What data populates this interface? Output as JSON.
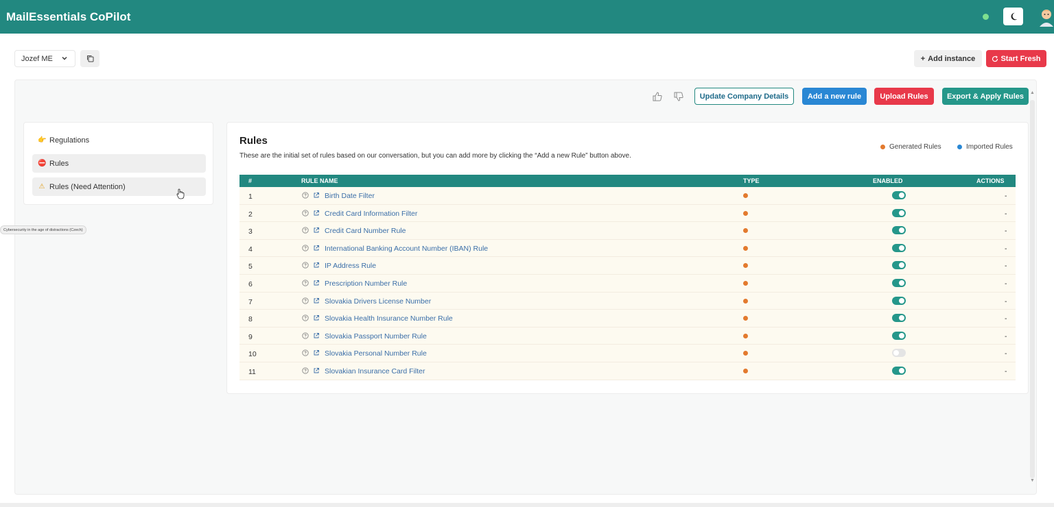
{
  "app": {
    "title": "MailEssentials CoPilot",
    "status_color": "#7ee08f"
  },
  "toolbar": {
    "instance_selected": "Jozef ME",
    "add_instance_label": "Add instance",
    "start_fresh_label": "Start Fresh"
  },
  "actions": {
    "update_company_label": "Update Company Details",
    "add_rule_label": "Add a new rule",
    "upload_rules_label": "Upload Rules",
    "export_apply_label": "Export & Apply Rules"
  },
  "sidebar": {
    "items": [
      {
        "label": "Regulations",
        "icon": "pointing-hand-icon",
        "active": false
      },
      {
        "label": "Rules",
        "icon": "no-entry-icon",
        "active": true
      },
      {
        "label": "Rules (Need Attention)",
        "icon": "warning-icon",
        "active": true
      }
    ]
  },
  "tooltip": "Cybersecurity in the age of distractions (Czech)",
  "rules": {
    "title": "Rules",
    "description": "These are the initial set of rules based on our conversation, but you can add more by clicking the “Add a new Rule” button above.",
    "legend": [
      {
        "label": "Generated Rules",
        "color": "#e37a2e"
      },
      {
        "label": "Imported Rules",
        "color": "#2987d4"
      }
    ],
    "columns": [
      "#",
      "RULE NAME",
      "TYPE",
      "ENABLED",
      "ACTIONS"
    ],
    "rows": [
      {
        "num": "1",
        "name": "Birth Date Filter",
        "type": "generated",
        "enabled": true,
        "actions": "-"
      },
      {
        "num": "2",
        "name": "Credit Card Information Filter",
        "type": "generated",
        "enabled": true,
        "actions": "-"
      },
      {
        "num": "3",
        "name": "Credit Card Number Rule",
        "type": "generated",
        "enabled": true,
        "actions": "-"
      },
      {
        "num": "4",
        "name": "International Banking Account Number (IBAN) Rule",
        "type": "generated",
        "enabled": true,
        "actions": "-"
      },
      {
        "num": "5",
        "name": "IP Address Rule",
        "type": "generated",
        "enabled": true,
        "actions": "-"
      },
      {
        "num": "6",
        "name": "Prescription Number Rule",
        "type": "generated",
        "enabled": true,
        "actions": "-"
      },
      {
        "num": "7",
        "name": "Slovakia Drivers License Number",
        "type": "generated",
        "enabled": true,
        "actions": "-"
      },
      {
        "num": "8",
        "name": "Slovakia Health Insurance Number Rule",
        "type": "generated",
        "enabled": true,
        "actions": "-"
      },
      {
        "num": "9",
        "name": "Slovakia Passport Number Rule",
        "type": "generated",
        "enabled": true,
        "actions": "-"
      },
      {
        "num": "10",
        "name": "Slovakia Personal Number Rule",
        "type": "generated",
        "enabled": false,
        "actions": "-"
      },
      {
        "num": "11",
        "name": "Slovakian Insurance Card Filter",
        "type": "generated",
        "enabled": true,
        "actions": "-"
      }
    ]
  }
}
